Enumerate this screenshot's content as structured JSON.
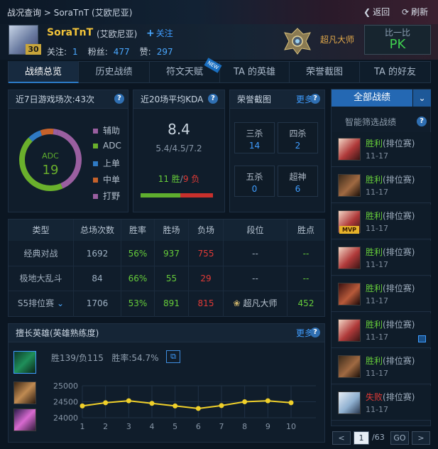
{
  "header": {
    "breadcrumb_root": "战况查询",
    "breadcrumb_sep": " > ",
    "breadcrumb_current": "SoraTnT (艾欧尼亚)",
    "back_label": "返回",
    "refresh_label": "刷新"
  },
  "player": {
    "name": "SoraTnT",
    "server": "(艾欧尼亚)",
    "level": "30",
    "follow_label": "关注",
    "following_label": "关注:",
    "following_count": "1",
    "fans_label": "粉丝:",
    "fans_count": "477",
    "likes_label": "赞:",
    "likes_count": "297",
    "rank": "超凡大师",
    "pk_top": "比一比",
    "pk_bottom": "PK"
  },
  "tabs": [
    {
      "label": "战绩总览",
      "active": true
    },
    {
      "label": "历史战绩"
    },
    {
      "label": "符文天赋",
      "badge": "NEW"
    },
    {
      "label": "TA 的英雄"
    },
    {
      "label": "荣誉截图"
    },
    {
      "label": "TA 的好友"
    }
  ],
  "recent7": {
    "title": "近7日游戏场次:43次",
    "center_label": "ADC",
    "center_value": "19",
    "legend": [
      "辅助",
      "ADC",
      "上单",
      "中单",
      "打野"
    ],
    "legend_colors": [
      "#9a5fa0",
      "#6ab02c",
      "#2f7ac4",
      "#c6622b",
      "#9a5fa0"
    ],
    "chart_data": {
      "type": "pie",
      "categories": [
        "辅助",
        "ADC",
        "上单",
        "中单",
        "打野"
      ],
      "values": [
        17,
        19,
        3,
        3,
        1
      ]
    }
  },
  "kda": {
    "title": "近20场平均KDA",
    "value": "8.4",
    "detail": "5.4/4.5/7.2",
    "wins_text": "11 胜",
    "sep": "/",
    "losses_text": "9 负",
    "wins": 11,
    "losses": 9
  },
  "honor": {
    "title": "荣誉截图",
    "more": "更多",
    "boxes": [
      {
        "label": "三杀",
        "value": "14"
      },
      {
        "label": "四杀",
        "value": "2"
      },
      {
        "label": "五杀",
        "value": "0"
      },
      {
        "label": "超神",
        "value": "6"
      }
    ]
  },
  "stats_table": {
    "headers": [
      "类型",
      "总场次数",
      "胜率",
      "胜场",
      "负场",
      "段位",
      "胜点"
    ],
    "rows": [
      {
        "type": "经典对战",
        "total": "1692",
        "rate": "56%",
        "wins": "937",
        "losses": "755",
        "rank": "--",
        "lp": "--"
      },
      {
        "type": "极地大乱斗",
        "total": "84",
        "rate": "66%",
        "wins": "55",
        "losses": "29",
        "rank": "--",
        "lp": "--"
      },
      {
        "type": "S5排位赛",
        "total": "1706",
        "rate": "53%",
        "wins": "891",
        "losses": "815",
        "rank": "超凡大师",
        "lp": "452"
      }
    ]
  },
  "mastery": {
    "title": "擅长英雄(英雄熟练度)",
    "more": "更多",
    "summary": "胜139/负115",
    "winrate": "胜率:54.7%",
    "chart_data": {
      "type": "line",
      "x": [
        1,
        2,
        3,
        4,
        5,
        6,
        7,
        8,
        9,
        10
      ],
      "series": [
        {
          "values": [
            24370,
            24470,
            24530,
            24450,
            24370,
            24290,
            24380,
            24500,
            24530,
            24470
          ]
        }
      ],
      "yticks": [
        24000,
        24500,
        25000
      ],
      "ylim": [
        24000,
        25000
      ],
      "color": "#f0d02a"
    }
  },
  "right_panel": {
    "all_label": "全部战绩",
    "filter_label": "智能筛选战绩",
    "matches": [
      {
        "result": "胜利",
        "mode": "(排位赛)",
        "date": "11-17",
        "win": true,
        "champ": "sivir",
        "mvp": false
      },
      {
        "result": "胜利",
        "mode": "(排位赛)",
        "date": "11-17",
        "win": true,
        "champ": "graves",
        "mvp": false
      },
      {
        "result": "胜利",
        "mode": "(排位赛)",
        "date": "11-17",
        "win": true,
        "champ": "sivir",
        "mvp": true,
        "mvp_label": "MVP"
      },
      {
        "result": "胜利",
        "mode": "(排位赛)",
        "date": "11-17",
        "win": true,
        "champ": "sivir",
        "mvp": false
      },
      {
        "result": "胜利",
        "mode": "(排位赛)",
        "date": "11-17",
        "win": true,
        "champ": "talon",
        "mvp": false
      },
      {
        "result": "胜利",
        "mode": "(排位赛)",
        "date": "11-17",
        "win": true,
        "champ": "sivir",
        "mvp": false,
        "shot": true
      },
      {
        "result": "胜利",
        "mode": "(排位赛)",
        "date": "11-17",
        "win": true,
        "champ": "graves",
        "mvp": false
      },
      {
        "result": "失败",
        "mode": "(排位赛)",
        "date": "11-17",
        "win": false,
        "champ": "ashe",
        "mvp": false
      }
    ],
    "pager": {
      "prev": "<",
      "page": "1",
      "total": "/63",
      "go": "GO",
      "next": ">"
    }
  }
}
